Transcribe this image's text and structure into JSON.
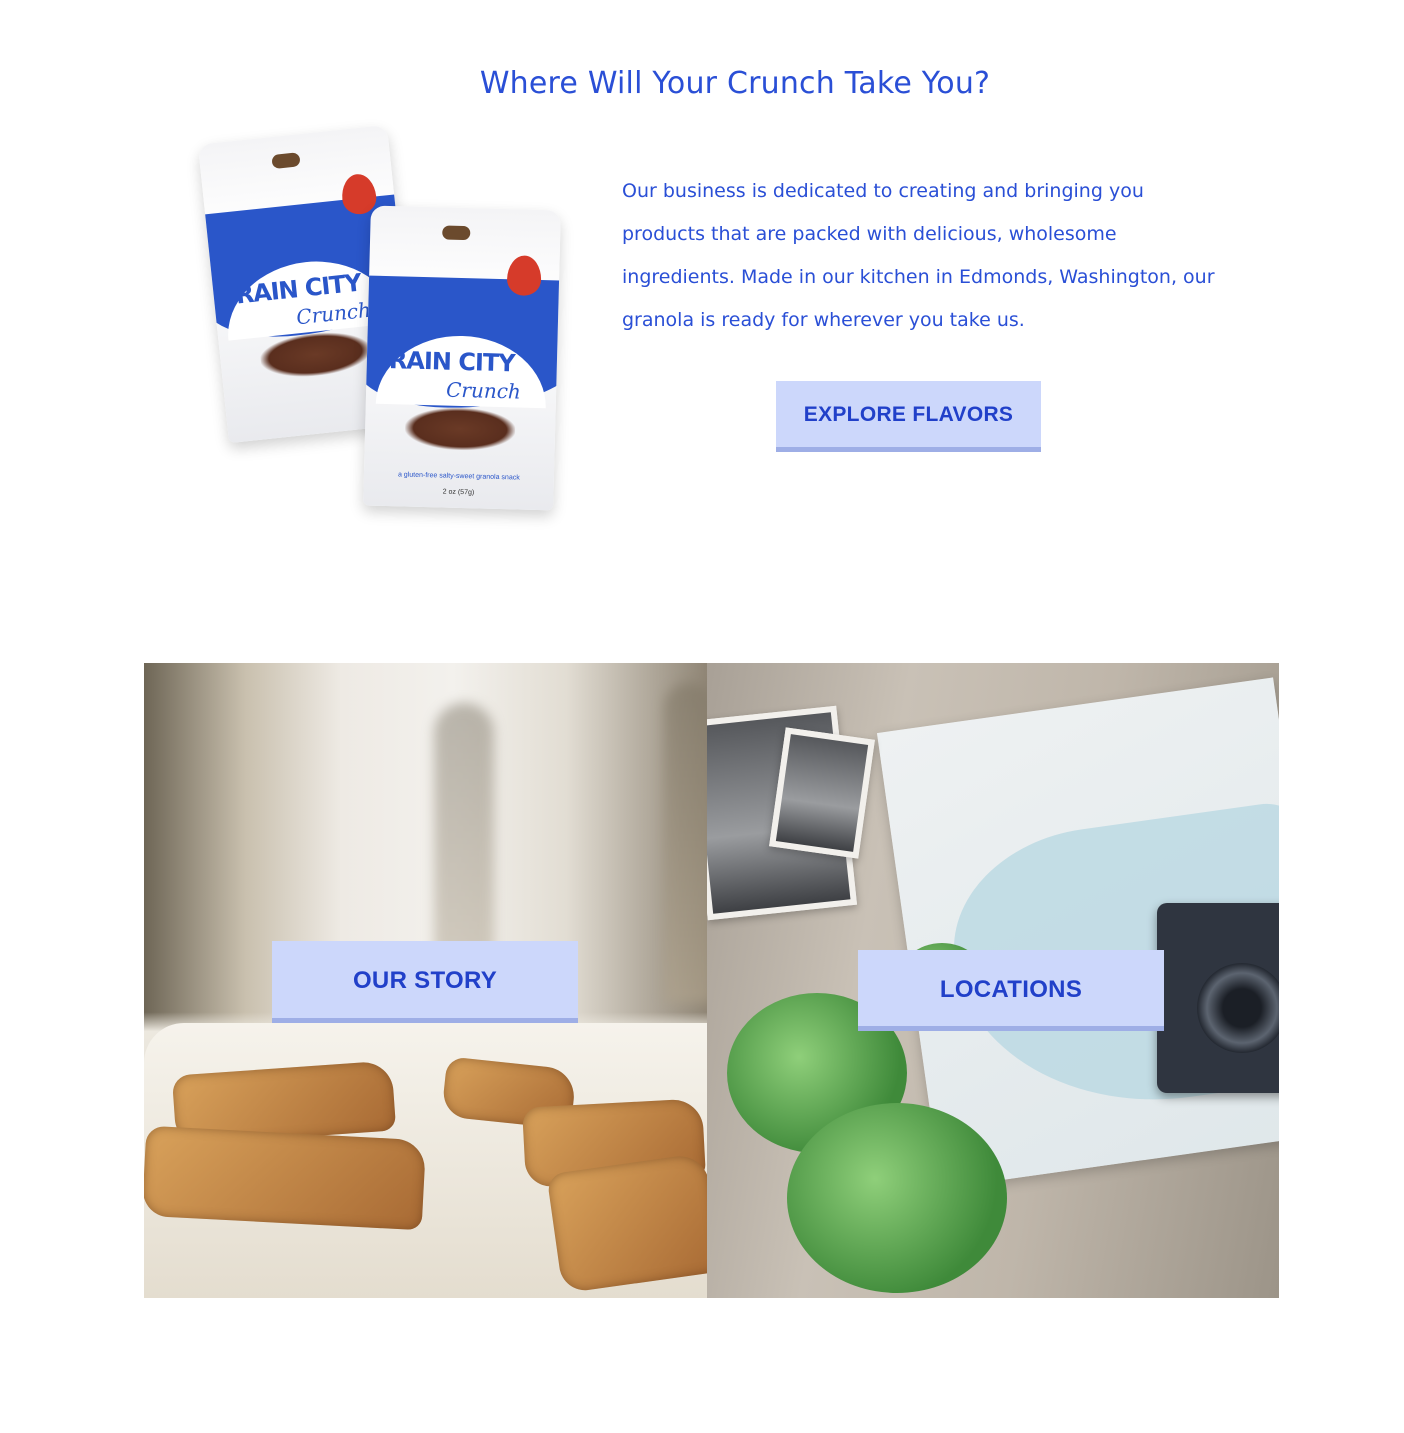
{
  "hero": {
    "headline": "Where Will Your Crunch Take You?",
    "intro": "Our business is dedicated to creating and bringing you products that are packed with delicious, wholesome ingredients. Made in our kitchen in Edmonds, Washington, our granola is ready for wherever you take us.",
    "cta_label": "EXPLORE FLAVORS"
  },
  "product": {
    "brand_line1": "RAIN CITY",
    "brand_line2": "Crunch",
    "tagline": "a gluten-free salty-sweet granola snack",
    "weight": "2 oz (57g)"
  },
  "tiles": [
    {
      "label": "OUR STORY",
      "image": "bakery-kitchen-granola-photo"
    },
    {
      "label": "LOCATIONS",
      "image": "map-photos-camera-photo"
    }
  ],
  "colors": {
    "brand_blue": "#2a4fd6",
    "button_bg": "#ccd7fb",
    "button_shadow": "#9eaee6"
  }
}
